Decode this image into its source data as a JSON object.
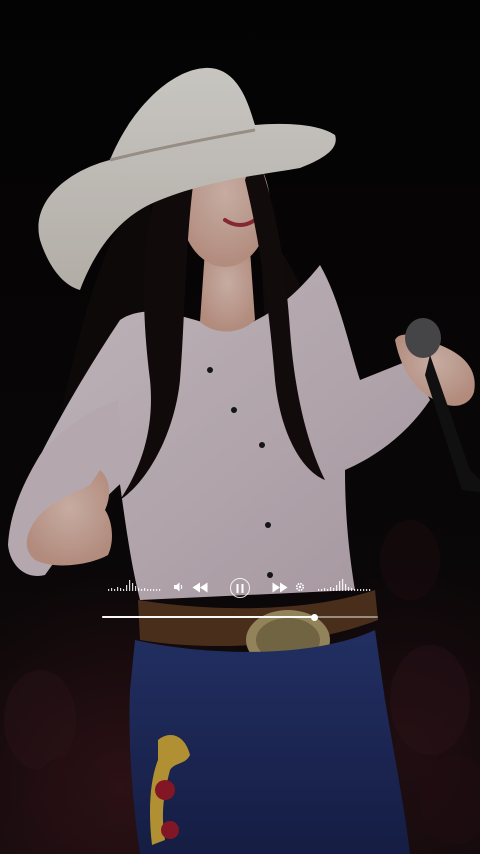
{
  "video": {
    "description_icon": "performer-photo",
    "background_color": "#0c0a0c"
  },
  "player": {
    "icons": {
      "equalizer_left": "equalizer-icon",
      "volume": "volume-icon",
      "rewind": "rewind-icon",
      "pause": "pause-icon",
      "fast_forward": "fast-forward-icon",
      "settings": "settings-icon",
      "equalizer_right": "equalizer-icon"
    },
    "progress": 0.77,
    "colors": {
      "controls": "#ffffff",
      "track": "rgba(255,255,255,0.45)"
    }
  }
}
